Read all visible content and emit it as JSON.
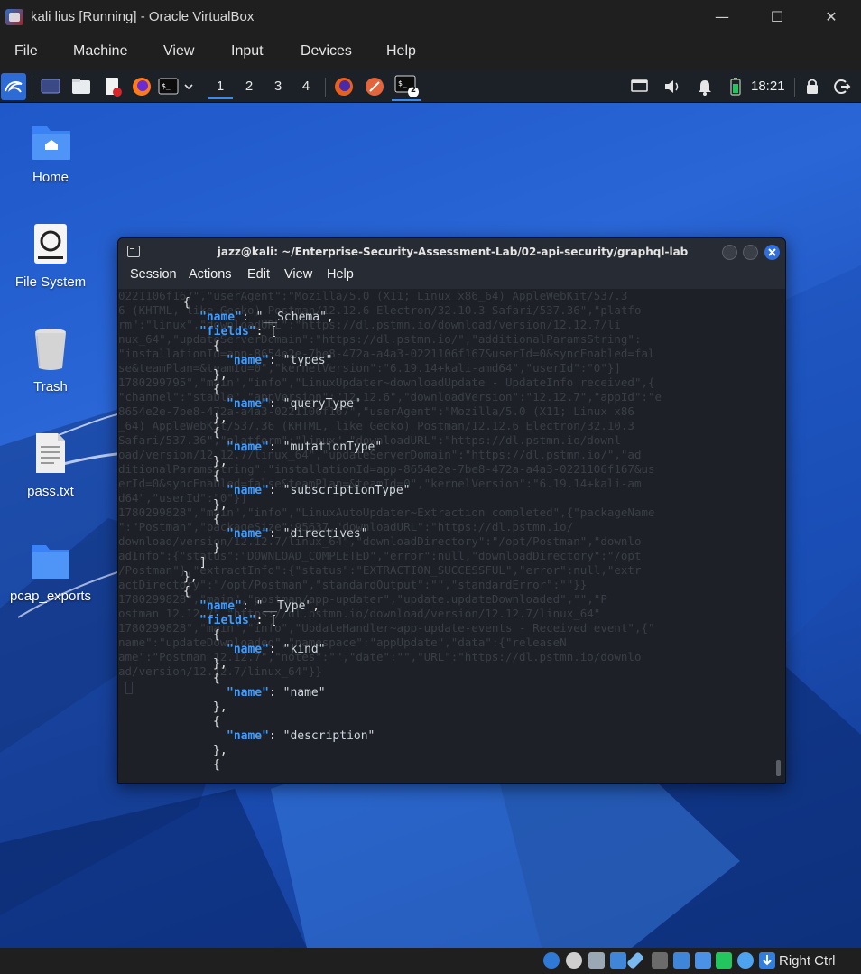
{
  "vbox": {
    "title": "kali lius [Running] - Oracle VirtualBox",
    "menu": [
      "File",
      "Machine",
      "View",
      "Input",
      "Devices",
      "Help"
    ],
    "host_key": "Right Ctrl"
  },
  "panel": {
    "workspaces": [
      "1",
      "2",
      "3",
      "4"
    ],
    "active_workspace": "1",
    "terminal_badge": "2",
    "clock": "18:21"
  },
  "desktop": {
    "icons": [
      {
        "label": "Home",
        "icon": "home-folder-icon"
      },
      {
        "label": "File System",
        "icon": "drive-icon"
      },
      {
        "label": "Trash",
        "icon": "trash-icon"
      },
      {
        "label": "pass.txt",
        "icon": "text-file-icon"
      },
      {
        "label": "pcap_exports",
        "icon": "folder-icon"
      }
    ]
  },
  "terminal": {
    "title": "jazz@kali: ~/Enterprise-Security-Assessment-Lab/02-api-security/graphql-lab",
    "menu": [
      "Session",
      "Actions",
      "Edit",
      "View",
      "Help"
    ],
    "colors": {
      "key": "#3f9cff",
      "string": "#d0d6dd",
      "background": "#1d2027",
      "close_button": "#2f6fe0"
    },
    "lines": [
      {
        "brace": "{"
      },
      {
        "key": "\"name\"",
        "punc": ": ",
        "val": "\"__Schema\"",
        "tail": ","
      },
      {
        "key": "\"fields\"",
        "punc": ": ",
        "val": "",
        "tail": "["
      },
      {
        "brace": "{"
      },
      {
        "key": "\"name\"",
        "punc": ": ",
        "val": "\"types\"",
        "tail": ""
      },
      {
        "brace": "},"
      },
      {
        "brace": "{"
      },
      {
        "key": "\"name\"",
        "punc": ": ",
        "val": "\"queryType\"",
        "tail": ""
      },
      {
        "brace": "},"
      },
      {
        "brace": "{"
      },
      {
        "key": "\"name\"",
        "punc": ": ",
        "val": "\"mutationType\"",
        "tail": ""
      },
      {
        "brace": "},"
      },
      {
        "brace": "{"
      },
      {
        "key": "\"name\"",
        "punc": ": ",
        "val": "\"subscriptionType\"",
        "tail": ""
      },
      {
        "brace": "},"
      },
      {
        "brace": "{"
      },
      {
        "key": "\"name\"",
        "punc": ": ",
        "val": "\"directives\"",
        "tail": ""
      },
      {
        "brace": "}"
      },
      {
        "brace": "]"
      },
      {
        "brace": "},"
      },
      {
        "brace": "{"
      },
      {
        "key": "\"name\"",
        "punc": ": ",
        "val": "\"__Type\"",
        "tail": ","
      },
      {
        "key": "\"fields\"",
        "punc": ": ",
        "val": "",
        "tail": "["
      },
      {
        "brace": "{"
      },
      {
        "key": "\"name\"",
        "punc": ": ",
        "val": "\"kind\"",
        "tail": ""
      },
      {
        "brace": "},"
      },
      {
        "brace": "{"
      },
      {
        "key": "\"name\"",
        "punc": ": ",
        "val": "\"name\"",
        "tail": ""
      },
      {
        "brace": "},"
      },
      {
        "brace": "{"
      },
      {
        "key": "\"name\"",
        "punc": ": ",
        "val": "\"description\"",
        "tail": ""
      },
      {
        "brace": "},"
      },
      {
        "brace": "{"
      }
    ],
    "ghost_text": [
      "0221106f167\",\"userAgent\":\"Mozilla/5.0 (X11; Linux x86_64) AppleWebKit/537.3",
      "6 (KHTML, like Gecko) Postman/12.12.6 Electron/32.10.3 Safari/537.36\",\"platfo",
      "rm\":\"linux\",\"downloadURL\":\"https://dl.pstmn.io/download/version/12.12.7/li",
      "nux_64\",\"updateServerDomain\":\"https://dl.pstmn.io/\",\"additionalParamsString\":",
      "\"installationId=app-8654e2e-7be8-472a-a4a3-0221106f167&userId=0&syncEnabled=fal",
      "se&teamPlan=&teamId=0\",\"kernelVersion\":\"6.19.14+kali-amd64\",\"userId\":\"0\"}]",
      "1780299795\",\"main\",\"info\",\"LinuxUpdater~downloadUpdate - UpdateInfo received\",{",
      "\"channel\":\"stable\",\"appVersion\":\"12.12.6\",\"downloadVersion\":\"12.12.7\",\"appId\":\"e",
      "8654e2e-7be8-472a-a4a3-0221106f167\",\"userAgent\":\"Mozilla/5.0 (X11; Linux x86",
      "_64) AppleWebKit/537.36 (KHTML, like Gecko) Postman/12.12.6 Electron/32.10.3",
      "Safari/537.36\",\"platform\":\"linux\",\"downloadURL\":\"https://dl.pstmn.io/downl",
      "oad/version/12.12.7/linux_64\",\"updateServerDomain\":\"https://dl.pstmn.io/\",\"ad",
      "ditionalParamsString\":\"installationId=app-8654e2e-7be8-472a-a4a3-0221106f167&us",
      "erId=0&syncEnabled=false&teamPlan=&teamId=0\",\"kernelVersion\":\"6.19.14+kali-am",
      "d64\",\"userId\":\"0\"}]",
      "1780299828\",\"main\",\"info\",\"LinuxAutoUpdater~Extraction completed\",{\"packageName",
      "\":\"Postman\",\"packageSize\":95637,\"downloadURL\":\"https://dl.pstmn.io/",
      "download/version/12.12.7/linux_64\",\"downloadDirectory\":\"/opt/Postman\",\"downlo",
      "adInfo\":{\"status\":\"DOWNLOAD_COMPLETED\",\"error\":null,\"downloadDirectory\":\"/opt",
      "/Postman\"},\"extractInfo\":{\"status\":\"EXTRACTION_SUCCESSFUL\",\"error\":null,\"extr",
      "actDirectory\":\"/opt/Postman\",\"standardOutput\":\"\",\"standardError\":\"\"}}",
      "1780299828\",\"main\",\"postman/app-updater\",\"update.updateDownloaded\",\"\",\"P",
      "ostman 12.12.7\",\"https://dl.pstmn.io/download/version/12.12.7/linux_64\"",
      "1780299828\",\"main\",\"info\",\"UpdateHandler~app-update-events - Received event\",{\"",
      "name\":\"updateDownloaded\",\"namespace\":\"appUpdate\",\"data\":{\"releaseN",
      "ame\":\"Postman 12.12.7\",\"notes\":\"\",\"date\":\"\",\"URL\":\"https://dl.pstmn.io/downlo",
      "ad/version/12.12.7/linux_64\"}}"
    ]
  }
}
